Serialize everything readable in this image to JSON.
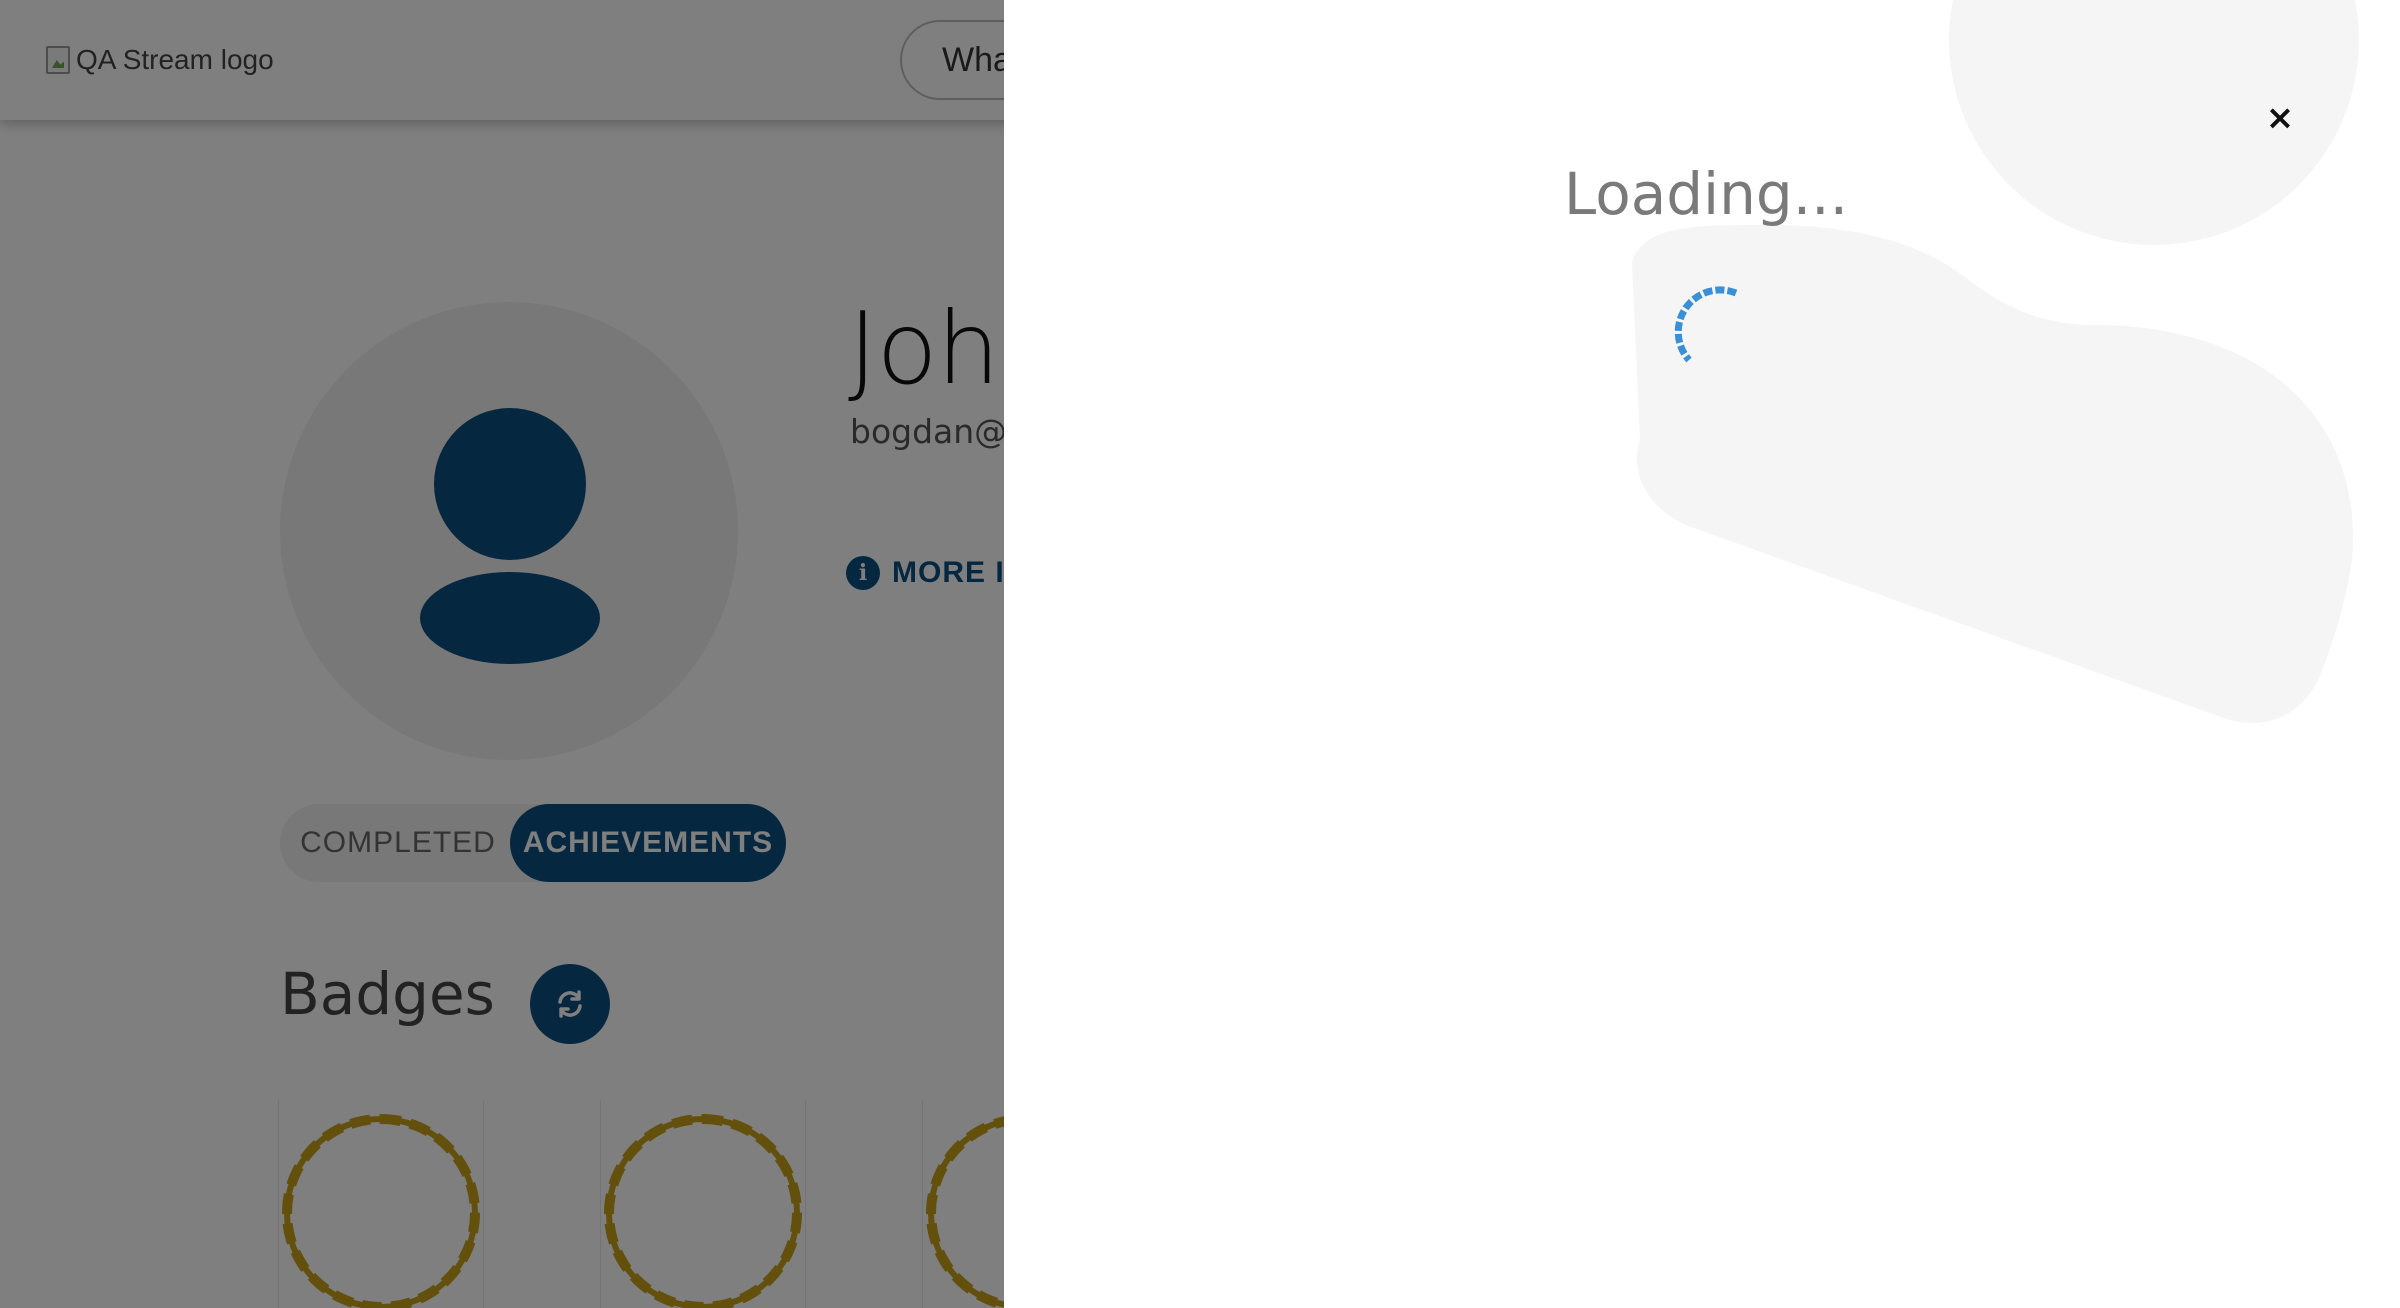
{
  "header": {
    "logo_alt": "QA Stream logo",
    "search_placeholder": "What"
  },
  "profile": {
    "name": "Joh",
    "email": "bogdan@",
    "more_info_label": "MORE IN",
    "icons": [
      "user-icon",
      "info-icon"
    ]
  },
  "tabs": [
    {
      "label": "COMPLETED",
      "active": false
    },
    {
      "label": "ACHIEVEMENTS",
      "active": true
    }
  ],
  "badges": {
    "title": "Badges",
    "refresh_icon": "refresh-icon"
  },
  "panel": {
    "loading_text": "Loading...",
    "close_icon": "×"
  },
  "colors": {
    "primary": "#0b4f81",
    "badge_gold": "#c9a01a",
    "spinner": "#3a8fd6",
    "overlay": "rgba(0,0,0,0.5)",
    "blob": "#f5f5f5"
  }
}
